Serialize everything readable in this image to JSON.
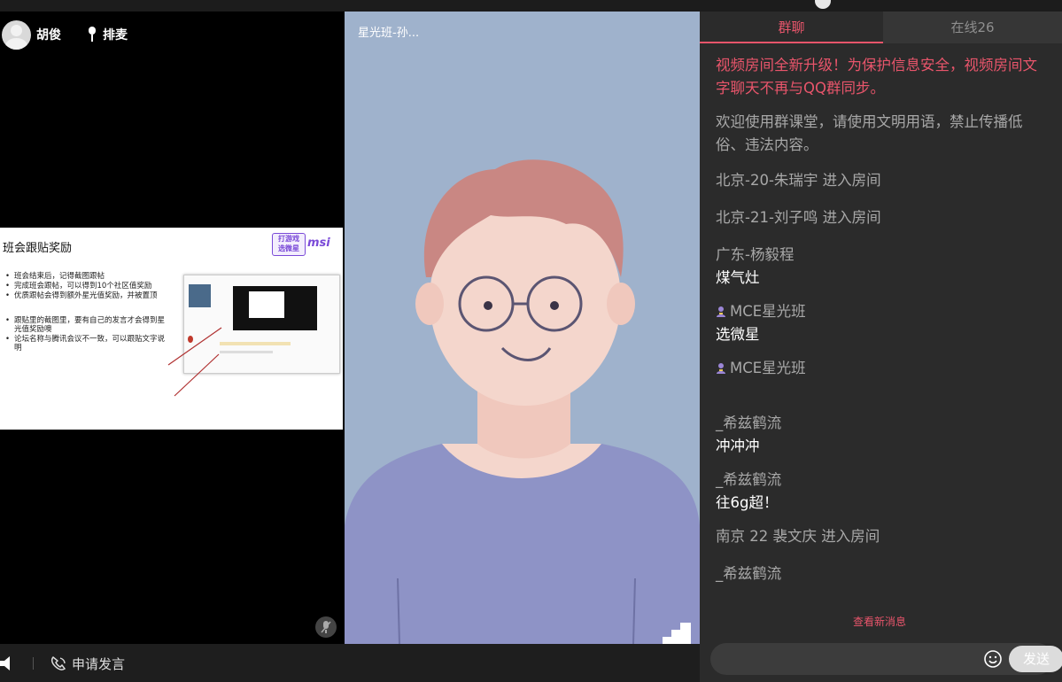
{
  "left_video": {
    "user_name": "胡俊",
    "queue_label": "排麦",
    "slide": {
      "title": "班会跟贴奖励",
      "logo_text": "打游戏\n选微星",
      "brand": "msi",
      "bullets": [
        "班会结束后，记得截图跟帖",
        "完成班会跟帖，可以得到10个社区值奖励",
        "优质跟帖会得到额外星光值奖励，并被置顶",
        "跟贴里的截图里，要有自己的发言才会得到星光值奖励噢",
        "论坛名称与腾讯会议不一致，可以跟贴文字说明"
      ]
    }
  },
  "center_video": {
    "label": "星光班-孙..."
  },
  "bottom_bar": {
    "apply_label": "申请发言"
  },
  "chat": {
    "tabs": {
      "group": "群聊",
      "online": "在线26"
    },
    "notice": "视频房间全新升级！为保护信息安全，视频房间文字聊天不再与QQ群同步。",
    "welcome": "欢迎使用群课堂，请使用文明用语，禁止传播低俗、违法内容。",
    "messages": [
      {
        "enter": "北京-20-朱瑞宇 进入房间"
      },
      {
        "enter": "北京-21-刘子鸣 进入房间"
      },
      {
        "sender": "广东-杨毅程",
        "content": "煤气灶"
      },
      {
        "sender": "MCE星光班",
        "content": "选微星"
      },
      {
        "sender": "MCE星光班",
        "content": ""
      },
      {
        "sender": "_希兹鹤流",
        "content": "冲冲冲"
      },
      {
        "sender": "_希兹鹤流",
        "content": "往6g超！"
      },
      {
        "enter": "南京 22 裴文庆 进入房间"
      },
      {
        "sender": "_希兹鹤流",
        "content": ""
      }
    ],
    "view_new": "查看新消息",
    "send_label": "发送",
    "colors": {
      "accent": "#e8556b",
      "panel": "#2b2b2b"
    }
  }
}
